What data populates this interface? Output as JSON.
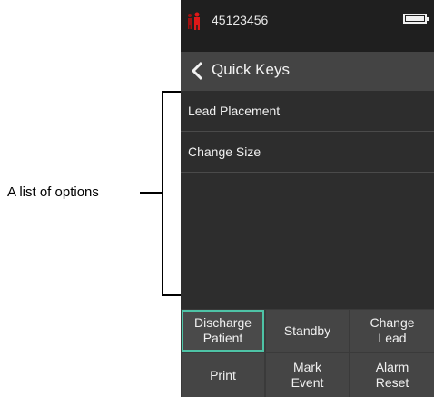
{
  "annotation": {
    "label": "A list of options"
  },
  "status_bar": {
    "patient_id": "45123456",
    "patient_icon": "patient-icon",
    "battery_icon": "battery-icon"
  },
  "header": {
    "title": "Quick Keys",
    "back_icon": "chevron-left-icon"
  },
  "list": {
    "items": [
      {
        "label": "Lead Placement"
      },
      {
        "label": "Change Size"
      }
    ]
  },
  "softkeys": [
    {
      "label": "Discharge\nPatient",
      "selected": true
    },
    {
      "label": "Standby"
    },
    {
      "label": "Change\nLead"
    },
    {
      "label": "Print"
    },
    {
      "label": "Mark\nEvent"
    },
    {
      "label": "Alarm\nReset"
    }
  ],
  "colors": {
    "selected_border": "#4ec3a6",
    "screen_background": "#2d2d2d",
    "title_bar": "#444444"
  }
}
